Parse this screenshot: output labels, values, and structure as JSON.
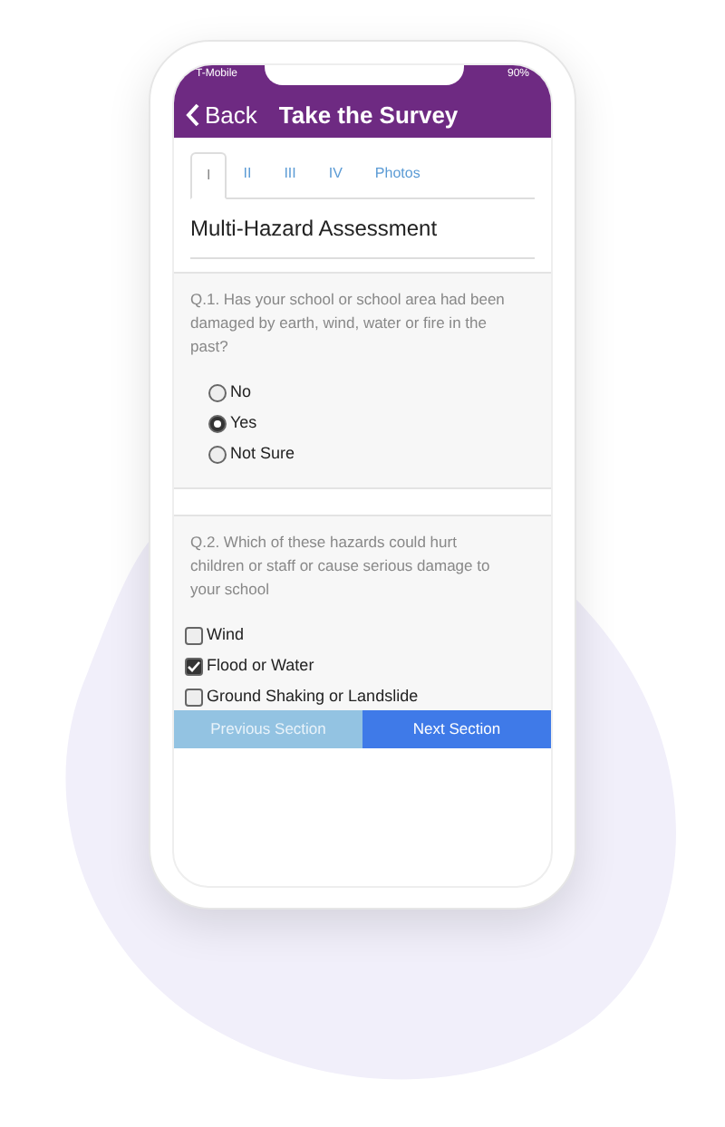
{
  "status_bar": {
    "carrier": "T-Mobile",
    "battery": "90%"
  },
  "header": {
    "back": "Back",
    "title": "Take the Survey"
  },
  "tabs": [
    {
      "label": "I",
      "selected": true
    },
    {
      "label": "II",
      "selected": false
    },
    {
      "label": "III",
      "selected": false
    },
    {
      "label": "IV",
      "selected": false
    },
    {
      "label": "Photos",
      "selected": false
    }
  ],
  "section_title": "Multi-Hazard Assessment",
  "questions": [
    {
      "kind": "radio",
      "prompt": "Q.1. Has your school or school area had been damaged by earth, wind, water or fire in the past?",
      "options": [
        {
          "label": "No",
          "selected": false
        },
        {
          "label": "Yes",
          "selected": true
        },
        {
          "label": "Not Sure",
          "selected": false
        }
      ]
    },
    {
      "kind": "checkbox",
      "prompt": "Q.2. Which of these hazards could hurt children or staff or cause serious damage to your school",
      "options": [
        {
          "label": "Wind",
          "checked": false
        },
        {
          "label": "Flood or Water",
          "checked": true
        },
        {
          "label": "Ground Shaking or Landslide",
          "checked": false
        }
      ]
    }
  ],
  "buttons": [
    {
      "label": "Previous Section",
      "kind": "secondary"
    },
    {
      "label": "Next Section",
      "kind": "primary"
    }
  ]
}
